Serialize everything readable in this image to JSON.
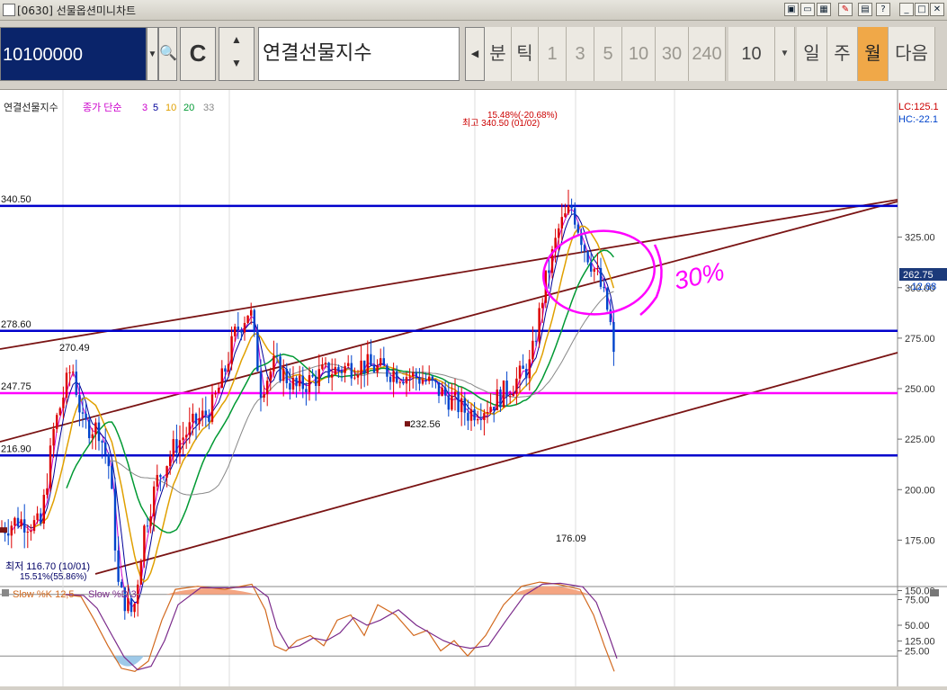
{
  "window": {
    "title": "[0630] 선물옵션미니차트",
    "buttons": [
      "▣",
      "▭",
      "▦",
      "✎",
      "▤",
      "?",
      "_",
      "□",
      "✕"
    ]
  },
  "toolbar": {
    "code": "10100000",
    "name": "연결선물지수",
    "periods": [
      {
        "label": "분",
        "active": false,
        "dim": false
      },
      {
        "label": "틱",
        "active": false,
        "dim": false
      },
      {
        "label": "1",
        "active": false,
        "dim": true
      },
      {
        "label": "3",
        "active": false,
        "dim": true
      },
      {
        "label": "5",
        "active": false,
        "dim": true
      },
      {
        "label": "10",
        "active": false,
        "dim": true
      },
      {
        "label": "30",
        "active": false,
        "dim": true
      },
      {
        "label": "240",
        "active": false,
        "dim": true
      }
    ],
    "count": "10",
    "span_buttons": [
      {
        "label": "일",
        "active": false
      },
      {
        "label": "주",
        "active": false
      },
      {
        "label": "월",
        "active": true
      }
    ],
    "next_label": "다음"
  },
  "chart": {
    "legend": {
      "name": "연결선물지수",
      "ma_label": "종가 단순",
      "ma_periods": [
        {
          "label": "3",
          "color": "#cc00cc"
        },
        {
          "label": "5",
          "color": "#000099"
        },
        {
          "label": "10",
          "color": "#e0a000"
        },
        {
          "label": "20",
          "color": "#009933"
        },
        {
          "label": "33",
          "color": "#888888"
        }
      ]
    },
    "lc_text": "LC:125.1",
    "hc_text": "HC:-22.1",
    "current_price": "262.75",
    "current_change": "-12.88",
    "stoch_label": "Slow %K 12,5",
    "stoch_d_label": "Slow %D 3",
    "high_note": "최고 340.50 (01/02)",
    "high_pct": "15.48%(-20.68%)",
    "low_note": "최저 116.70 (10/01)",
    "low_pct": "15.51%(55.86%)",
    "handwriting": "30%",
    "colors": {
      "up": "#dd0000",
      "down": "#0044cc",
      "hline": "#0000cc",
      "magenta": "#ff00ff",
      "channel": "#7a1414"
    }
  },
  "chart_data": {
    "type": "candlestick",
    "y_axis_ticks": [
      "325.00",
      "300.00",
      "275.00",
      "250.00",
      "225.00",
      "200.00",
      "175.00",
      "150.00",
      "125.00"
    ],
    "stoch_ticks": [
      "75.00",
      "50.00",
      "25.00"
    ],
    "ylim": [
      105,
      350
    ],
    "hlines": [
      {
        "label": "340.50",
        "value": 340.5,
        "color": "#0000cc"
      },
      {
        "label": "278.60",
        "value": 278.6,
        "color": "#0000cc"
      },
      {
        "label": "247.75",
        "value": 247.75,
        "color": "#ff00ff"
      },
      {
        "label": "216.90",
        "value": 216.9,
        "color": "#0000cc"
      }
    ],
    "annotations": [
      {
        "label": "270.49",
        "value": 270.49
      },
      {
        "label": "232.56",
        "value": 232.56
      },
      {
        "label": "176.09",
        "value": 176.09
      }
    ]
  }
}
